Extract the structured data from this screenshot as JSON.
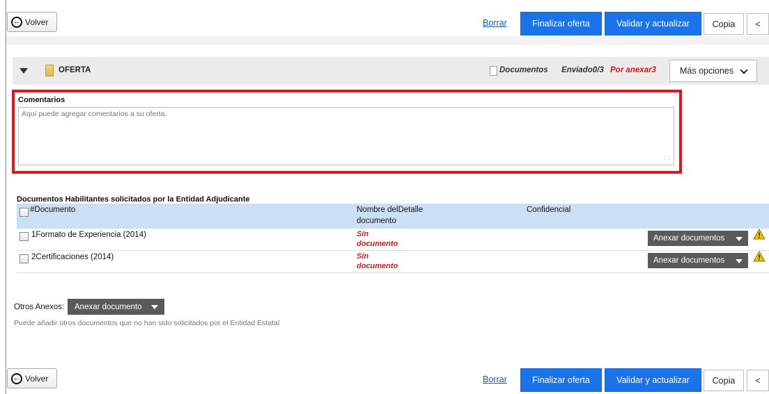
{
  "toolbar": {
    "volver_label": "Volver",
    "borrar_label": "Borrar",
    "finalizar_label": "Finalizar oferta",
    "validar_label": "Validar y actualizar",
    "copia_label": "Copia",
    "collapse_label": "<"
  },
  "oferta": {
    "title": "OFERTA",
    "documentos_label": "Documentos",
    "enviado_label": "Enviado0/3",
    "por_anexar_label": "Por anexar3",
    "mas_opciones_label": "Más opciones"
  },
  "comentarios": {
    "label": "Comentarios",
    "placeholder": "Aquí puede agregar comentarios a su oferta."
  },
  "documentos": {
    "section_title": "Documentos Habilitantes solicitados por la Entidad Adjudicante",
    "columns": {
      "documento": "#Documento",
      "nombre_line1": "Nombre delDetalle",
      "nombre_line2": "documento",
      "confidencial": "Confidencial"
    },
    "rows": [
      {
        "name": "1Formato de Experiencia (2014)",
        "status_line1": "Sin",
        "status_line2": "documento",
        "action_label": "Anexar documentos"
      },
      {
        "name": "2Certificaciones (2014)",
        "status_line1": "Sin",
        "status_line2": "documento",
        "action_label": "Anexar documentos"
      }
    ]
  },
  "otros": {
    "label": "Otros Anexos:",
    "button_label": "Anexar documento",
    "hint": "Puede añadir otros documentos que no han sido solicitados por el Entidad Estatal"
  },
  "colors": {
    "primary_blue": "#1a73e8",
    "highlight_red": "#e3141c",
    "warning_red": "#d21a1a",
    "header_blue": "#cce0f5",
    "dark_button": "#5a5a5a"
  }
}
